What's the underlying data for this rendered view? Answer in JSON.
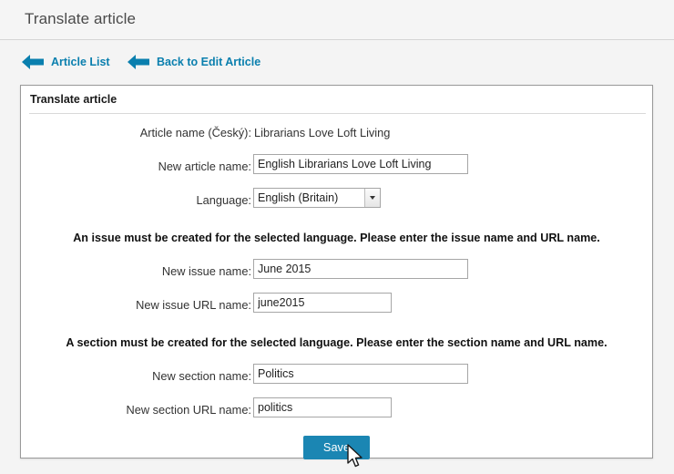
{
  "window": {
    "title": "Translate article"
  },
  "nav": {
    "links": [
      {
        "label": "Article List",
        "icon": "left-arrow-icon"
      },
      {
        "label": "Back to Edit Article",
        "icon": "left-arrow-icon"
      }
    ]
  },
  "panel": {
    "heading": "Translate article",
    "fields": {
      "article_name_label": "Article name (Český):",
      "article_name_value": "Librarians Love Loft Living",
      "new_article_name_label": "New article name:",
      "new_article_name_value": "English Librarians Love Loft Living",
      "language_label": "Language:",
      "language_value": "English (Britain)",
      "language_options": [
        "English (Britain)"
      ],
      "new_issue_name_label": "New issue name:",
      "new_issue_name_value": "June 2015",
      "new_issue_url_label": "New issue URL name:",
      "new_issue_url_value": "june2015",
      "new_section_name_label": "New section name:",
      "new_section_name_value": "Politics",
      "new_section_url_label": "New section URL name:",
      "new_section_url_value": "politics"
    },
    "notices": {
      "issue": "An issue must be created for the selected language. Please enter the issue name and URL name.",
      "section": "A section must be created for the selected language. Please enter the section name and URL name."
    },
    "save_label": "Save"
  },
  "colors": {
    "link": "#0a7fae",
    "button": "#1b86b3",
    "page_bg": "#f4f4f4",
    "panel_bg": "#ffffff",
    "panel_border": "#999999"
  }
}
